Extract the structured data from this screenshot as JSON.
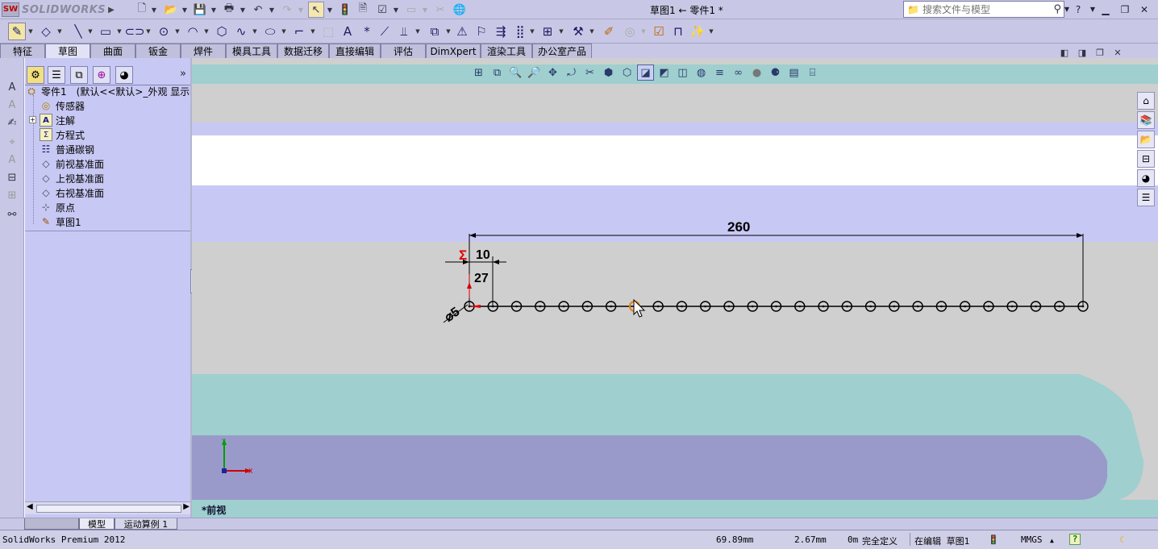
{
  "app": {
    "brand": "SOLIDWORKS",
    "brand_badge": "SW",
    "document_title": "草图1 ← 零件1 *"
  },
  "search": {
    "placeholder": "搜索文件与模型",
    "help_icon": "?"
  },
  "command_tabs": [
    "特征",
    "草图",
    "曲面",
    "钣金",
    "焊件",
    "模具工具",
    "数据迁移",
    "直接编辑",
    "评估",
    "DimXpert",
    "渲染工具",
    "办公室产品"
  ],
  "active_tab": "草图",
  "feature_tree": {
    "root_label": "零件1",
    "root_config": "(默认<<默认>_外观 显示状",
    "items": [
      {
        "label": "传感器",
        "icon": "sensor-icon"
      },
      {
        "label": "注解",
        "icon": "annotation-icon",
        "expandable": true
      },
      {
        "label": "方程式",
        "icon": "equation-icon"
      },
      {
        "label": "普通碳钢",
        "icon": "material-icon"
      },
      {
        "label": "前视基准面",
        "icon": "plane-icon"
      },
      {
        "label": "上视基准面",
        "icon": "plane-icon"
      },
      {
        "label": "右视基准面",
        "icon": "plane-icon"
      },
      {
        "label": "原点",
        "icon": "origin-icon"
      },
      {
        "label": "草图1",
        "icon": "sketch-icon"
      }
    ]
  },
  "sketch": {
    "dim_overall": "260",
    "dim_spacing": "10",
    "dim_height": "27",
    "dim_diameter": "⌀5",
    "sigma_symbol": "Σ",
    "circle_count": 27,
    "selected_circle_index": 7
  },
  "viewport": {
    "view_name": "*前视",
    "triad_x": "X",
    "triad_y": "Y"
  },
  "bottom_tabs": [
    "模型",
    "运动算例 1"
  ],
  "status": {
    "product": "SolidWorks Premium 2012",
    "x_coord": "69.89mm",
    "y_coord": "2.67mm",
    "z_coord": "0m",
    "definition": "完全定义",
    "mode": "在编辑 草图1",
    "units": "MMGS",
    "units_arrow": "▲",
    "help": "?"
  },
  "colors": {
    "frame": "#c8c8e6",
    "panel": "#c8c8f4",
    "viewport_gray": "#cfcfcf",
    "band_lilac": "#c8c8f4",
    "band_teal": "#9fcfcf",
    "band_purple": "#9a9aca",
    "sketch_line": "#000000",
    "selection_orange": "#e88010",
    "dimension_red": "#e00000"
  }
}
